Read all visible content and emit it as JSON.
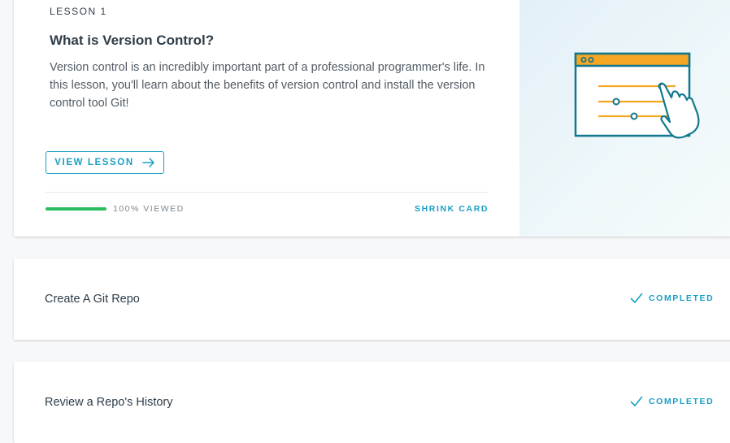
{
  "current_lesson": {
    "eyebrow": "LESSON 1",
    "title": "What is Version Control?",
    "description": "Version control is an incredibly important part of a professional programmer's life. In this lesson, you'll learn about the benefits of version control and install the version control tool Git!",
    "view_button_label": "VIEW LESSON",
    "progress_fraction": 1.0,
    "progress_label": "100% VIEWED",
    "shrink_label": "SHRINK CARD",
    "illustration_icon": "browser-window-sliders-hand-icon"
  },
  "lessons": [
    {
      "title": "Create A Git Repo",
      "status_label": "COMPLETED",
      "status_icon": "checkmark-icon"
    },
    {
      "title": "Review a Repo's History",
      "status_label": "COMPLETED",
      "status_icon": "checkmark-icon"
    }
  ],
  "colors": {
    "accent": "#1a9fc3",
    "progress": "#2dbe60",
    "illustration_orange": "#f5a623",
    "illustration_teal": "#12788f"
  }
}
